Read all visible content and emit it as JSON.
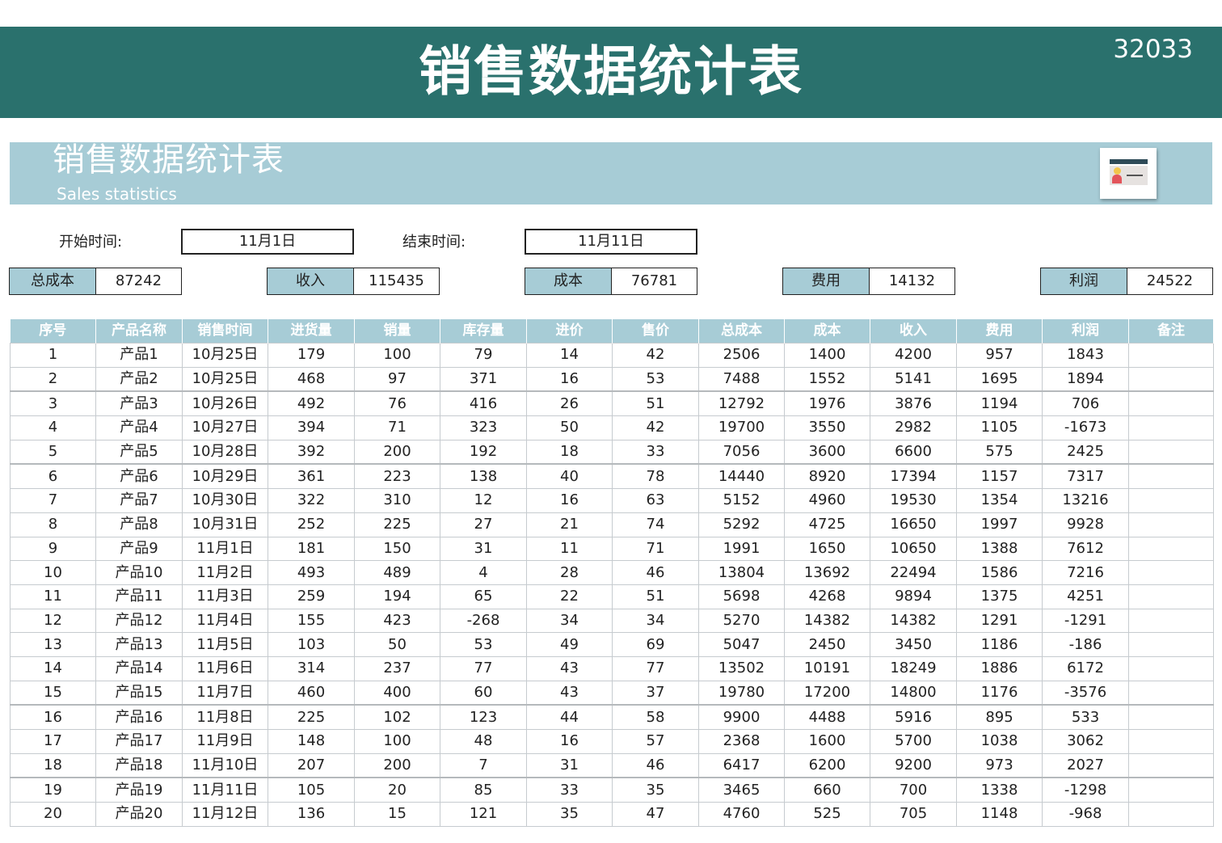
{
  "banner": {
    "title": "销售数据统计表",
    "code": "32033"
  },
  "subbanner": {
    "title": "销售数据统计表",
    "subtitle": "Sales statistics",
    "icon": "presenter-card-icon"
  },
  "filters": {
    "start_label": "开始时间:",
    "start_value": "11月1日",
    "end_label": "结束时间:",
    "end_value": "11月11日"
  },
  "summary": [
    {
      "label": "总成本",
      "value": "87242"
    },
    {
      "label": "收入",
      "value": "115435"
    },
    {
      "label": "成本",
      "value": "76781"
    },
    {
      "label": "费用",
      "value": "14132"
    },
    {
      "label": "利润",
      "value": "24522"
    }
  ],
  "table": {
    "headers": [
      "序号",
      "产品名称",
      "销售时间",
      "进货量",
      "销量",
      "库存量",
      "进价",
      "售价",
      "总成本",
      "成本",
      "收入",
      "费用",
      "利润",
      "备注"
    ],
    "rows": [
      [
        "1",
        "产品1",
        "10月25日",
        "179",
        "100",
        "79",
        "14",
        "42",
        "2506",
        "1400",
        "4200",
        "957",
        "1843",
        ""
      ],
      [
        "2",
        "产品2",
        "10月25日",
        "468",
        "97",
        "371",
        "16",
        "53",
        "7488",
        "1552",
        "5141",
        "1695",
        "1894",
        ""
      ],
      [
        "3",
        "产品3",
        "10月26日",
        "492",
        "76",
        "416",
        "26",
        "51",
        "12792",
        "1976",
        "3876",
        "1194",
        "706",
        ""
      ],
      [
        "4",
        "产品4",
        "10月27日",
        "394",
        "71",
        "323",
        "50",
        "42",
        "19700",
        "3550",
        "2982",
        "1105",
        "-1673",
        ""
      ],
      [
        "5",
        "产品5",
        "10月28日",
        "392",
        "200",
        "192",
        "18",
        "33",
        "7056",
        "3600",
        "6600",
        "575",
        "2425",
        ""
      ],
      [
        "6",
        "产品6",
        "10月29日",
        "361",
        "223",
        "138",
        "40",
        "78",
        "14440",
        "8920",
        "17394",
        "1157",
        "7317",
        ""
      ],
      [
        "7",
        "产品7",
        "10月30日",
        "322",
        "310",
        "12",
        "16",
        "63",
        "5152",
        "4960",
        "19530",
        "1354",
        "13216",
        ""
      ],
      [
        "8",
        "产品8",
        "10月31日",
        "252",
        "225",
        "27",
        "21",
        "74",
        "5292",
        "4725",
        "16650",
        "1997",
        "9928",
        ""
      ],
      [
        "9",
        "产品9",
        "11月1日",
        "181",
        "150",
        "31",
        "11",
        "71",
        "1991",
        "1650",
        "10650",
        "1388",
        "7612",
        ""
      ],
      [
        "10",
        "产品10",
        "11月2日",
        "493",
        "489",
        "4",
        "28",
        "46",
        "13804",
        "13692",
        "22494",
        "1586",
        "7216",
        ""
      ],
      [
        "11",
        "产品11",
        "11月3日",
        "259",
        "194",
        "65",
        "22",
        "51",
        "5698",
        "4268",
        "9894",
        "1375",
        "4251",
        ""
      ],
      [
        "12",
        "产品12",
        "11月4日",
        "155",
        "423",
        "-268",
        "34",
        "34",
        "5270",
        "14382",
        "14382",
        "1291",
        "-1291",
        ""
      ],
      [
        "13",
        "产品13",
        "11月5日",
        "103",
        "50",
        "53",
        "49",
        "69",
        "5047",
        "2450",
        "3450",
        "1186",
        "-186",
        ""
      ],
      [
        "14",
        "产品14",
        "11月6日",
        "314",
        "237",
        "77",
        "43",
        "77",
        "13502",
        "10191",
        "18249",
        "1886",
        "6172",
        ""
      ],
      [
        "15",
        "产品15",
        "11月7日",
        "460",
        "400",
        "60",
        "43",
        "37",
        "19780",
        "17200",
        "14800",
        "1176",
        "-3576",
        ""
      ],
      [
        "16",
        "产品16",
        "11月8日",
        "225",
        "102",
        "123",
        "44",
        "58",
        "9900",
        "4488",
        "5916",
        "895",
        "533",
        ""
      ],
      [
        "17",
        "产品17",
        "11月9日",
        "148",
        "100",
        "48",
        "16",
        "57",
        "2368",
        "1600",
        "5700",
        "1038",
        "3062",
        ""
      ],
      [
        "18",
        "产品18",
        "11月10日",
        "207",
        "200",
        "7",
        "31",
        "46",
        "6417",
        "6200",
        "9200",
        "973",
        "2027",
        ""
      ],
      [
        "19",
        "产品19",
        "11月11日",
        "105",
        "20",
        "85",
        "33",
        "35",
        "3465",
        "660",
        "700",
        "1338",
        "-1298",
        ""
      ],
      [
        "20",
        "产品20",
        "11月12日",
        "136",
        "15",
        "121",
        "35",
        "47",
        "4760",
        "525",
        "705",
        "1148",
        "-968",
        ""
      ]
    ]
  },
  "colors": {
    "banner": "#2a716d",
    "accent": "#a7ccd6"
  }
}
